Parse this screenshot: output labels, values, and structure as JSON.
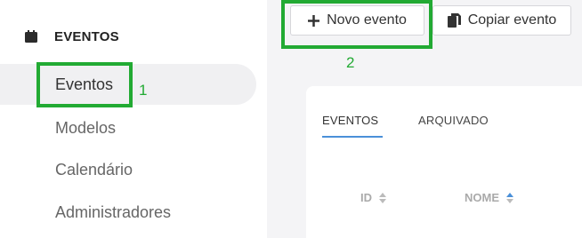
{
  "sidebar": {
    "section_title": "EVENTOS",
    "section_icon": "calendar-icon",
    "items": [
      {
        "label": "Eventos",
        "active": true
      },
      {
        "label": "Modelos",
        "active": false
      },
      {
        "label": "Calendário",
        "active": false
      },
      {
        "label": "Administradores",
        "active": false
      }
    ]
  },
  "toolbar": {
    "new_event_label": "Novo evento",
    "new_event_icon": "plus-icon",
    "copy_event_label": "Copiar evento",
    "copy_event_icon": "copy-icon"
  },
  "tabs": [
    {
      "label": "EVENTOS",
      "active": true
    },
    {
      "label": "ARQUIVADO",
      "active": false
    }
  ],
  "table": {
    "columns": [
      {
        "label": "ID",
        "sort": "none"
      },
      {
        "label": "NOME",
        "sort": "ascending"
      }
    ]
  },
  "annotations": [
    {
      "label": "1",
      "target": "sidebar-item-eventos"
    },
    {
      "label": "2",
      "target": "new-event-button"
    }
  ],
  "colors": {
    "annotation": "#22aa33",
    "accent": "#4a90d9",
    "active_bg": "#f0f0f2"
  }
}
